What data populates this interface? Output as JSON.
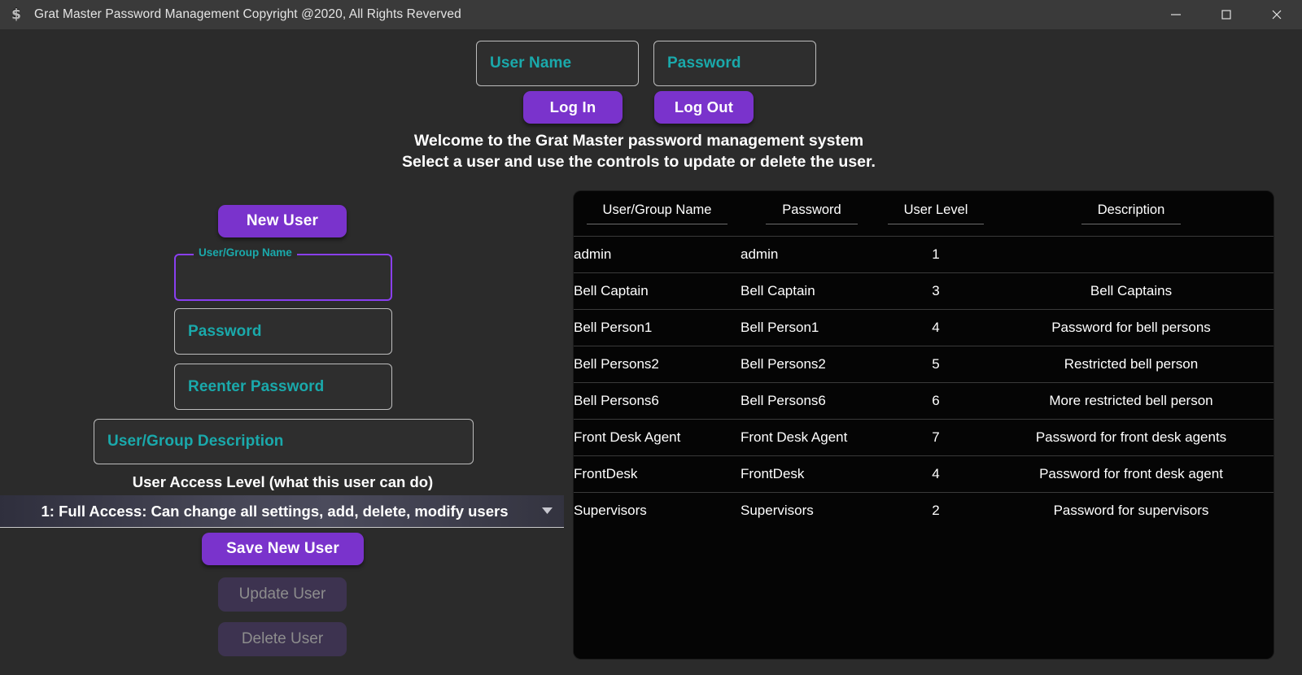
{
  "window": {
    "title": "Grat Master Password Management Copyright @2020, All Rights Reverved",
    "app_icon": "dollar-sign-icon",
    "minimize": "—",
    "maximize": "□",
    "close": "✕"
  },
  "login": {
    "username_placeholder": "User Name",
    "username_value": "",
    "password_placeholder": "Password",
    "password_value": "",
    "login_label": "Log In",
    "logout_label": "Log Out"
  },
  "welcome": {
    "line1": "Welcome to the Grat Master password management system",
    "line2": "Select a user and use the controls to update or delete the user."
  },
  "form": {
    "new_user_label": "New User",
    "name_label": "User/Group Name",
    "name_value": "",
    "password_placeholder": "Password",
    "password_value": "",
    "reenter_placeholder": "Reenter Password",
    "reenter_value": "",
    "description_placeholder": "User/Group Description",
    "description_value": "",
    "access_level_label": "User Access Level (what this user can do)",
    "access_level_selected": "1: Full Access: Can change all settings, add, delete, modify users",
    "save_label": "Save New User",
    "update_label": "Update User",
    "delete_label": "Delete User"
  },
  "table": {
    "headers": [
      "User/Group Name",
      "Password",
      "User Level",
      "Description"
    ],
    "rows": [
      {
        "name": "admin",
        "password": "admin",
        "level": "1",
        "description": ""
      },
      {
        "name": "Bell Captain",
        "password": "Bell Captain",
        "level": "3",
        "description": "Bell Captains"
      },
      {
        "name": "Bell Person1",
        "password": "Bell Person1",
        "level": "4",
        "description": "Password for bell persons"
      },
      {
        "name": "Bell Persons2",
        "password": "Bell Persons2",
        "level": "5",
        "description": "Restricted bell person"
      },
      {
        "name": "Bell Persons6",
        "password": "Bell Persons6",
        "level": "6",
        "description": "More restricted bell person"
      },
      {
        "name": "Front Desk Agent",
        "password": "Front Desk Agent",
        "level": "7",
        "description": "Password for front desk agents"
      },
      {
        "name": "FrontDesk",
        "password": "FrontDesk",
        "level": "4",
        "description": "Password for front desk agent"
      },
      {
        "name": "Supervisors",
        "password": "Supervisors",
        "level": "2",
        "description": "Password for supervisors"
      }
    ]
  },
  "colors": {
    "accent_purple": "#7a33cc",
    "focus_purple": "#8a3ff0",
    "placeholder_teal": "#1aa9ab",
    "window_bg": "#2b2b2b",
    "titlebar_bg": "#3a3a3a",
    "table_bg": "#050505"
  }
}
